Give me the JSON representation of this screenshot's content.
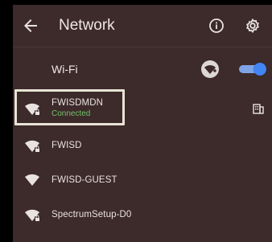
{
  "header": {
    "title": "Network"
  },
  "wifi": {
    "label": "Wi-Fi",
    "toggle_on": true
  },
  "networks": [
    {
      "name": "FWISDMDN",
      "status": "Connected",
      "secure": true,
      "enterprise": true
    },
    {
      "name": "FWISD",
      "secure": true
    },
    {
      "name": "FWISD-GUEST",
      "secure": false
    },
    {
      "name": "SpectrumSetup-D0",
      "secure": true
    }
  ],
  "colors": {
    "accent": "#4285f4",
    "connected": "#72c26a",
    "background": "#3d2a2a"
  }
}
